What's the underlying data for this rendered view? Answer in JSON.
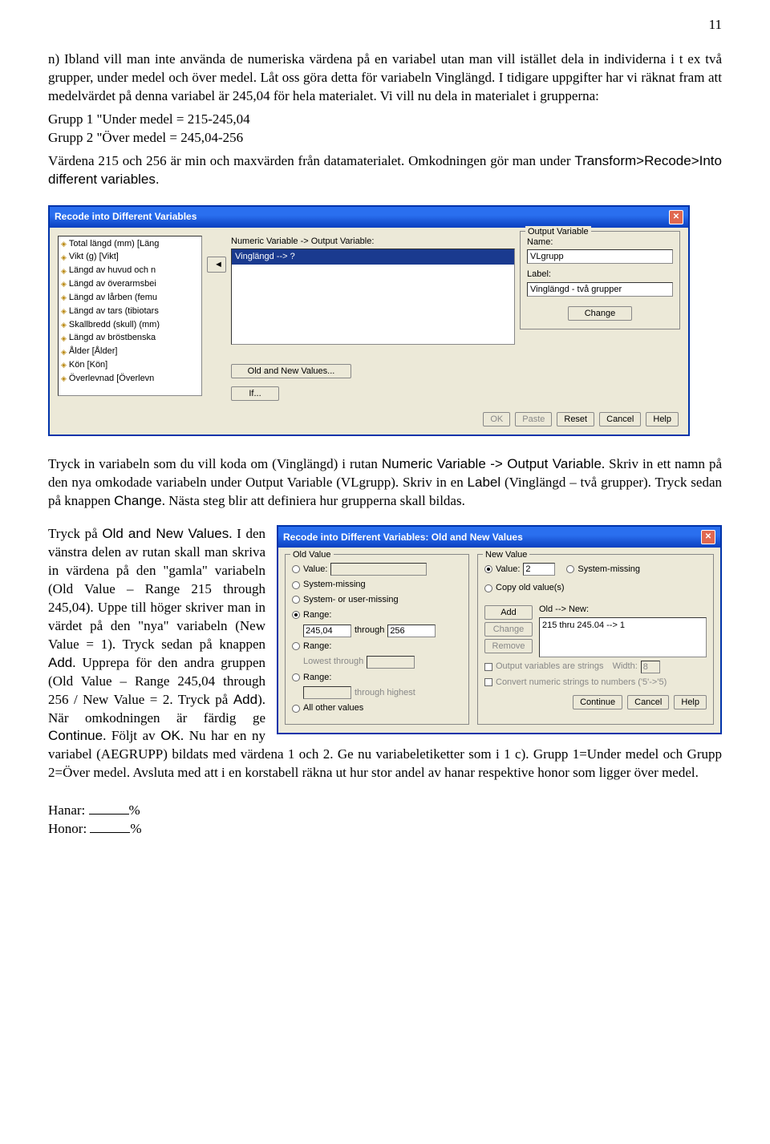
{
  "page_number": "11",
  "body_text": {
    "p1": "n) Ibland vill man inte använda de numeriska värdena på en variabel utan man vill istället dela in individerna i t ex två grupper, under medel och över medel. Låt oss göra detta för variabeln Vinglängd. I tidigare uppgifter har vi räknat fram att medelvärdet på denna variabel är 245,04 för hela materialet. Vi vill nu dela in materialet i grupperna:",
    "g1": "Grupp 1 \"Under medel = 215-245,04",
    "g2": "Grupp 2 \"Över medel = 245,04-256",
    "p2a": "Värdena 215 och 256 är min och maxvärden från datamaterialet. Omkodningen gör man under ",
    "p2b": "Transform>Recode>Into different variables.",
    "p3a": "Tryck in variabeln som du vill koda om (Vinglängd) i rutan ",
    "p3b": "Numeric Variable -> Output Variable",
    "p3c": ". Skriv in ett namn på den nya omkodade variabeln under Output Variable (VLgrupp). Skriv in en ",
    "p3d": "Label",
    "p3e": " (Vinglängd – två grupper). Tryck sedan på knappen ",
    "p3f": "Change",
    "p3g": ". Nästa steg blir att definiera hur grupperna skall bildas.",
    "p4a": "Tryck på ",
    "p4b": "Old and New Values",
    "p4c": ". I den vänstra delen av rutan skall man skriva in värdena på den \"gamla\" variabeln (Old Value – Range 215 through 245,04). Uppe till höger skriver man in värdet på den \"nya\" variabeln (New Value = 1). Tryck sedan på knappen ",
    "p4d": "Add",
    "p4e": ". Upprepa för den andra gruppen (Old Value – Range 245,04 through 256 / New Value = 2. Tryck på ",
    "p4f": "Add",
    "p4g": "). När omkodningen är färdig ge ",
    "p4h": "Continue",
    "p4i": ". Följt av ",
    "p4j": "OK",
    "p4k": ". Nu har en ny variabel (AEGRUPP) bildats med värdena 1 och 2. Ge nu variabeletiketter som i 1 c). Grupp 1=Under medel och Grupp 2=Över medel. Avsluta med att i en korstabell räkna ut hur stor andel av hanar respektive honor som ligger över medel.",
    "hanar": "Hanar:",
    "honor": "Honor:",
    "pct": "%"
  },
  "dialog1": {
    "title": "Recode into Different Variables",
    "vars": [
      "Total längd (mm) [Läng",
      "Vikt (g) [Vikt]",
      "Längd av huvud och n",
      "Längd av överarmsbei",
      "Längd av lårben (femu",
      "Längd av tars (tibiotars",
      "Skallbredd (skull) (mm)",
      "Längd av bröstbenska",
      "Ålder [Ålder]",
      "Kön [Kön]",
      "Överlevnad [Överlevn"
    ],
    "arrow": "◄",
    "mid_label": "Numeric Variable -> Output Variable:",
    "mid_item": "Vinglängd --> ?",
    "old_new_btn": "Old and New Values...",
    "if_btn": "If...",
    "out_legend": "Output Variable",
    "name_lbl": "Name:",
    "name_val": "VLgrupp",
    "label_lbl": "Label:",
    "label_val": "Vinglängd - två grupper",
    "change_btn": "Change",
    "btns": {
      "ok": "OK",
      "paste": "Paste",
      "reset": "Reset",
      "cancel": "Cancel",
      "help": "Help"
    }
  },
  "dialog2": {
    "title": "Recode into Different Variables: Old and New Values",
    "old": {
      "legend": "Old Value",
      "value": "Value:",
      "sysmiss": "System-missing",
      "sysuser": "System- or user-missing",
      "range": "Range:",
      "through": "through",
      "r1": "245,04",
      "r2": "256",
      "range_low": "Lowest through",
      "range_high": "through highest",
      "all_other": "All other values"
    },
    "new": {
      "legend": "New Value",
      "value": "Value:",
      "val": "2",
      "sysmiss": "System-missing",
      "copy": "Copy old value(s)",
      "oldnew_lbl": "Old --> New:",
      "list_item": "215 thru 245.04 --> 1",
      "add": "Add",
      "change": "Change",
      "remove": "Remove",
      "out_str": "Output variables are strings",
      "width": "Width:",
      "width_v": "8",
      "convert": "Convert numeric strings to numbers ('5'->'5)",
      "continue": "Continue",
      "cancel": "Cancel",
      "help": "Help"
    }
  }
}
